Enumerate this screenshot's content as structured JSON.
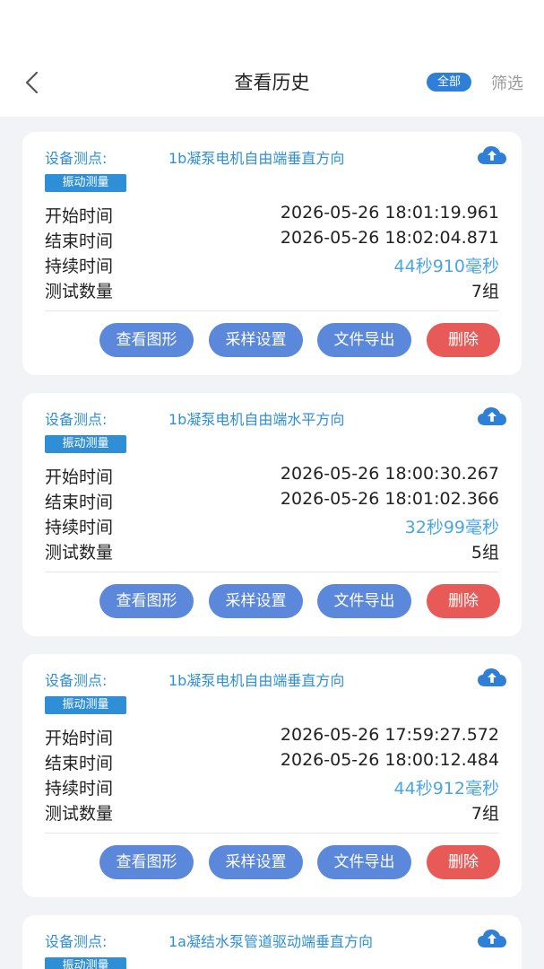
{
  "header": {
    "title": "查看历史",
    "filter_badge": "全部",
    "filter_link": "筛选"
  },
  "labels": {
    "point": "设备测点:",
    "start": "开始时间",
    "end": "结束时间",
    "duration": "持续时间",
    "count": "测试数量"
  },
  "actions": {
    "view_graph": "查看图形",
    "sample_settings": "采样设置",
    "export_file": "文件导出",
    "delete": "删除"
  },
  "records": [
    {
      "point_name": "1b凝泵电机自由端垂直方向",
      "type": "振动测量",
      "start_time": "2026-05-26 18:01:19.961",
      "end_time": "2026-05-26 18:02:04.871",
      "duration": "44秒910毫秒",
      "count": "7组"
    },
    {
      "point_name": "1b凝泵电机自由端水平方向",
      "type": "振动测量",
      "start_time": "2026-05-26 18:00:30.267",
      "end_time": "2026-05-26 18:01:02.366",
      "duration": "32秒99毫秒",
      "count": "5组"
    },
    {
      "point_name": "1b凝泵电机自由端垂直方向",
      "type": "振动测量",
      "start_time": "2026-05-26 17:59:27.572",
      "end_time": "2026-05-26 18:00:12.484",
      "duration": "44秒912毫秒",
      "count": "7组"
    },
    {
      "point_name": "1a凝结水泵管道驱动端垂直方向",
      "type": "振动测量"
    }
  ],
  "icons": {
    "back": "chevron-left-icon",
    "upload": "cloud-upload-icon"
  },
  "colors": {
    "accent": "#2f8fd6",
    "button_blue": "#5b88db",
    "button_red": "#e85a57"
  }
}
